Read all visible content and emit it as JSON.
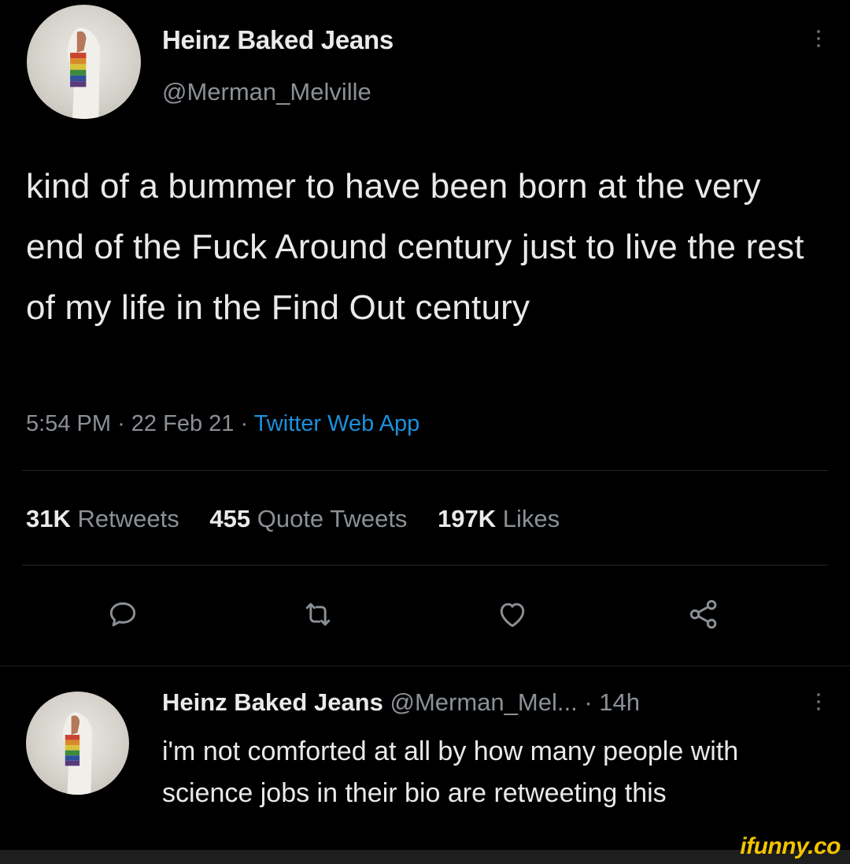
{
  "tweet": {
    "author_name": "Heinz Baked Jeans",
    "author_handle": "@Merman_Melville",
    "text": "kind of a bummer to have been born at the very end of the Fuck Around century just to live the rest of my life in the Find Out century",
    "time": "5:54 PM",
    "separator": "·",
    "date": "22 Feb 21",
    "source": "Twitter Web App",
    "stats": {
      "retweets_count": "31K",
      "retweets_label": "Retweets",
      "quotes_count": "455",
      "quotes_label": "Quote Tweets",
      "likes_count": "197K",
      "likes_label": "Likes"
    },
    "actions": [
      "reply-icon",
      "retweet-icon",
      "like-icon",
      "share-icon"
    ]
  },
  "reply": {
    "author_name": "Heinz Baked Jeans",
    "author_handle": "@Merman_Mel...",
    "separator": "·",
    "age": "14h",
    "text": "i'm not comforted at all by how many people with science jobs in their bio are retweeting this"
  },
  "watermark": {
    "text": "ifunny.co",
    "color": "#f3c300"
  },
  "colors": {
    "background": "#000000",
    "primary_text": "#e7e9ea",
    "secondary_text": "#8b9096",
    "link": "#1d8fdb"
  }
}
